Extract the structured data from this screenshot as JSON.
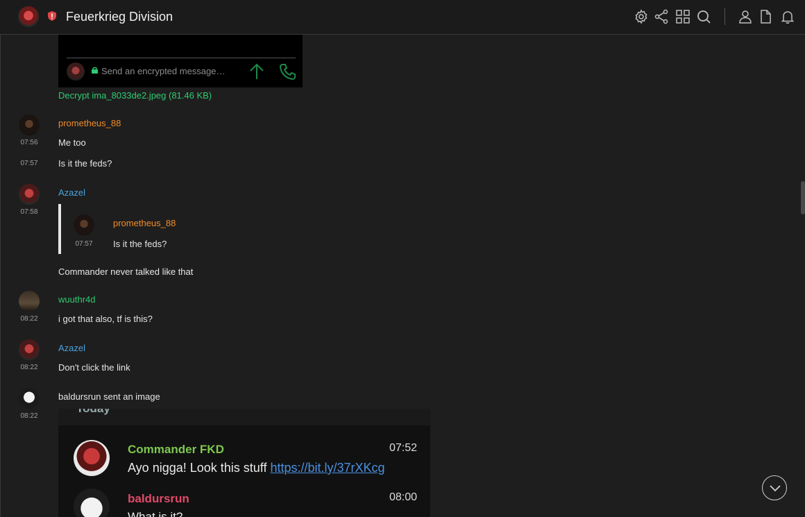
{
  "header": {
    "room_name": "Feuerkrieg Division"
  },
  "toolbar_icons": [
    "settings-icon",
    "share-icon",
    "grid-icon",
    "search-icon",
    "user-icon",
    "file-icon",
    "bell-icon"
  ],
  "colors": {
    "orange_sender": "#f28c28",
    "blue_sender": "#4aa3df",
    "green_sender": "#2ecc71",
    "background": "#1e1e1e"
  },
  "image1": {
    "placeholder": "Send an encrypted message…",
    "decrypt_link": "Decrypt ima_8033de2.jpeg (81.46 KB)"
  },
  "messages": {
    "m1": {
      "sender": "prometheus_88",
      "time": "07:56",
      "text": "Me too"
    },
    "m2": {
      "time": "07:57",
      "text": "Is it the feds?"
    },
    "m3": {
      "sender": "Azazel",
      "time": "07:58",
      "quote": {
        "sender": "prometheus_88",
        "time": "07:57",
        "text": "Is it the feds?"
      },
      "text": "Commander never talked like that"
    },
    "m4": {
      "sender": "wuuthr4d",
      "time": "08:22",
      "text": "i got that also, tf is this?"
    },
    "m5": {
      "sender": "Azazel",
      "time": "08:22",
      "text": "Don't click the link"
    },
    "m6": {
      "time": "08:22",
      "text": "baldursrun sent an image"
    }
  },
  "image2": {
    "header": "Today",
    "msg1": {
      "name": "Commander FKD",
      "time": "07:52",
      "text": "Ayo nigga! Look this stuff ",
      "url": "https://bit.ly/37rXKcg"
    },
    "msg2": {
      "name": "baldursrun",
      "time": "08:00",
      "text": "What is it?"
    }
  }
}
